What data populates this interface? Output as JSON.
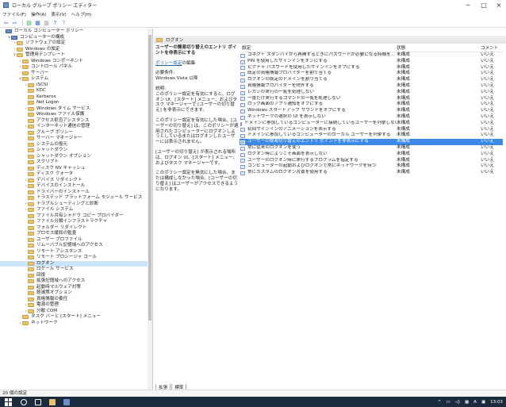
{
  "window": {
    "title": "ローカル グループ ポリシー エディター",
    "minimize": "─",
    "maximize": "□",
    "close": "×"
  },
  "menu": [
    "ファイル(F)",
    "操作(A)",
    "表示(V)",
    "ヘルプ(H)"
  ],
  "toolbar": {
    "back": "⇦",
    "forward": "⇨",
    "up": "▤",
    "view1": "▦",
    "help": "?",
    "view2": "▥",
    "filter": "⊤"
  },
  "tree": [
    {
      "indent": 0,
      "arrow": "",
      "type": "pc",
      "label": "ローカル コンピューター ポリシー"
    },
    {
      "indent": 1,
      "arrow": "∨",
      "type": "pc",
      "label": "コンピューターの構成"
    },
    {
      "indent": 2,
      "arrow": "›",
      "type": "folder",
      "label": "ソフトウェアの設定"
    },
    {
      "indent": 2,
      "arrow": "›",
      "type": "folder",
      "label": "Windows の設定"
    },
    {
      "indent": 2,
      "arrow": "∨",
      "type": "folder",
      "label": "管理用テンプレート"
    },
    {
      "indent": 3,
      "arrow": "›",
      "type": "folder",
      "label": "Windows コンポーネント"
    },
    {
      "indent": 3,
      "arrow": "›",
      "type": "folder",
      "label": "コントロール パネル"
    },
    {
      "indent": 3,
      "arrow": "",
      "type": "folder",
      "label": "サーバー"
    },
    {
      "indent": 3,
      "arrow": "∨",
      "type": "folder",
      "label": "システム"
    },
    {
      "indent": 4,
      "arrow": "›",
      "type": "folder",
      "label": "iSCSI"
    },
    {
      "indent": 4,
      "arrow": "",
      "type": "folder",
      "label": "KDC"
    },
    {
      "indent": 4,
      "arrow": "",
      "type": "folder",
      "label": "Kerberos"
    },
    {
      "indent": 4,
      "arrow": "",
      "type": "folder",
      "label": "Net Logon"
    },
    {
      "indent": 4,
      "arrow": "›",
      "type": "folder",
      "label": "Windows タイム サービス"
    },
    {
      "indent": 4,
      "arrow": "",
      "type": "folder",
      "label": "Windows ファイル保護"
    },
    {
      "indent": 4,
      "arrow": "",
      "type": "folder",
      "label": "アクセス拒否アシスタンス"
    },
    {
      "indent": 4,
      "arrow": "›",
      "type": "folder",
      "label": "インターネット通信の管理"
    },
    {
      "indent": 4,
      "arrow": "",
      "type": "folder",
      "label": "グループ ポリシー"
    },
    {
      "indent": 4,
      "arrow": "",
      "type": "folder",
      "label": "サーバー マネージャー"
    },
    {
      "indent": 4,
      "arrow": "",
      "type": "folder",
      "label": "システムの復元"
    },
    {
      "indent": 4,
      "arrow": "",
      "type": "folder",
      "label": "シャットダウン"
    },
    {
      "indent": 4,
      "arrow": "",
      "type": "folder",
      "label": "シャットダウン オプション"
    },
    {
      "indent": 4,
      "arrow": "",
      "type": "folder",
      "label": "スクリプト"
    },
    {
      "indent": 4,
      "arrow": "",
      "type": "folder",
      "label": "ディスク NV キャッシュ"
    },
    {
      "indent": 4,
      "arrow": "",
      "type": "folder",
      "label": "ディスク クォータ"
    },
    {
      "indent": 4,
      "arrow": "›",
      "type": "folder",
      "label": "デバイス リダイレクト"
    },
    {
      "indent": 4,
      "arrow": "›",
      "type": "folder",
      "label": "デバイスのインストール"
    },
    {
      "indent": 4,
      "arrow": "",
      "type": "folder",
      "label": "ドライバーのインストール"
    },
    {
      "indent": 4,
      "arrow": "",
      "type": "folder",
      "label": "トラステッド プラットフォーム モジュール サービス"
    },
    {
      "indent": 4,
      "arrow": "›",
      "type": "folder",
      "label": "トラブルシューティングと診断"
    },
    {
      "indent": 4,
      "arrow": "›",
      "type": "folder",
      "label": "ファイル システム"
    },
    {
      "indent": 4,
      "arrow": "",
      "type": "folder",
      "label": "ファイル共有シャドウ コピー プロバイダー"
    },
    {
      "indent": 4,
      "arrow": "",
      "type": "folder",
      "label": "ファイル分類インフラストラクチャ"
    },
    {
      "indent": 4,
      "arrow": "",
      "type": "folder",
      "label": "フォルダー リダイレクト"
    },
    {
      "indent": 4,
      "arrow": "",
      "type": "folder",
      "label": "プロセス緩和の監査"
    },
    {
      "indent": 4,
      "arrow": "",
      "type": "folder",
      "label": "ユーザー プロファイル"
    },
    {
      "indent": 4,
      "arrow": "",
      "type": "folder",
      "label": "リムーバブル記憶域へのアクセス"
    },
    {
      "indent": 4,
      "arrow": "",
      "type": "folder",
      "label": "リモート アシスタンス"
    },
    {
      "indent": 4,
      "arrow": "",
      "type": "folder",
      "label": "リモート プロシージャ コール"
    },
    {
      "indent": 4,
      "arrow": "",
      "type": "folder",
      "label": "ログオン",
      "selected": true
    },
    {
      "indent": 4,
      "arrow": "",
      "type": "folder",
      "label": "ロケール サービス"
    },
    {
      "indent": 4,
      "arrow": "",
      "type": "folder",
      "label": "回復"
    },
    {
      "indent": 4,
      "arrow": "",
      "type": "folder",
      "label": "拡張記憶域へのアクセス"
    },
    {
      "indent": 4,
      "arrow": "",
      "type": "folder",
      "label": "起動時マルウェア対策"
    },
    {
      "indent": 4,
      "arrow": "",
      "type": "folder",
      "label": "軽減策オプション"
    },
    {
      "indent": 4,
      "arrow": "",
      "type": "folder",
      "label": "資格情報の委任"
    },
    {
      "indent": 4,
      "arrow": "›",
      "type": "folder",
      "label": "電源の管理"
    },
    {
      "indent": 4,
      "arrow": "›",
      "type": "folder",
      "label": "分散 COM"
    },
    {
      "indent": 3,
      "arrow": "",
      "type": "folder",
      "label": "タスク バーと [スタート] メニュー"
    },
    {
      "indent": 3,
      "arrow": "›",
      "type": "folder",
      "label": "ネットワーク"
    }
  ],
  "header": {
    "title": "ログオン"
  },
  "description": {
    "heading": "ユーザーの簡易切り替えのエントリ ポイントを非表示にする",
    "edit_prefix": "",
    "edit_link": "ポリシー設定",
    "edit_suffix": "の編集",
    "requirements_label": "必要条件:",
    "requirements_value": "Windows Vista 以降",
    "desc_label": "説明:",
    "p1": "このポリシー設定を有効にすると、ログオン UI、[スタート] メニュー、およびタスク マネージャーで [ユーザーの切り替え] を非表示にできます。",
    "p2": "このポリシー設定を有効にした場合、[ユーザーの切り替え] は、このポリシーが適用されたコンピューターにログオンしようとしているまたはログオンしたユーザーには表示されません。",
    "p3": "[ユーザーの切り替え] が表示される場所は、ログオン UI、[スタート] メニュー、およびタスク マネージャーです。",
    "p4": "このポリシー設定を無効にした場合、または構成しなかった場合、[ユーザーの切り替え] はユーザーがアクセスできるようになります。"
  },
  "table": {
    "headers": {
      "setting": "設定",
      "state": "状態",
      "comment": "コメント"
    },
    "rows": [
      {
        "setting": "コネクト スタンバイから再開するときにパスワードが必要になる時間を...",
        "state": "未構成",
        "comment": "いいえ"
      },
      {
        "setting": "PIN を使用したサインインをオンにする",
        "state": "未構成",
        "comment": "いいえ"
      },
      {
        "setting": "ピクチャ パスワードを使用したサインインをオフにする",
        "state": "未構成",
        "comment": "いいえ"
      },
      {
        "setting": "既定の資格情報プロバイダーを割り当てる",
        "state": "未構成",
        "comment": "いいえ"
      },
      {
        "setting": "ログオンの既定のドメインを割り当てる",
        "state": "未構成",
        "comment": "いいえ"
      },
      {
        "setting": "資格情報プロバイダーを除外する",
        "state": "未構成",
        "comment": "いいえ"
      },
      {
        "setting": "レガシの実行の一覧を処理しない",
        "state": "未構成",
        "comment": "いいえ"
      },
      {
        "setting": "一度だけ実行するコマンドの一覧を処理しない",
        "state": "未構成",
        "comment": "いいえ"
      },
      {
        "setting": "ロック画面のアプリ通知をオフにする",
        "state": "未構成",
        "comment": "いいえ"
      },
      {
        "setting": "Windows スタートアップ サウンドをオフにする",
        "state": "未構成",
        "comment": "いいえ"
      },
      {
        "setting": "ネットワークの選択の UI を表示しない",
        "state": "未構成",
        "comment": "いいえ"
      },
      {
        "setting": "ドメインに参加しているコンピューターに接続しているユーザーを列挙しない",
        "state": "未構成",
        "comment": "いいえ"
      },
      {
        "setting": "初回サインインのアニメーションを表示する",
        "state": "未構成",
        "comment": "いいえ"
      },
      {
        "setting": "ドメインに参加しているコンピューターのローカル ユーザーを列挙する",
        "state": "未構成",
        "comment": "いいえ"
      },
      {
        "setting": "ユーザーの簡易切り替えのエントリ ポイントを非表示にする",
        "state": "未構成",
        "comment": "いいえ",
        "selected": true
      },
      {
        "setting": "常に従来のログオンを使う",
        "state": "未構成",
        "comment": "いいえ"
      },
      {
        "setting": "ログオン時にようこそ画面を表示しない",
        "state": "未構成",
        "comment": "いいえ"
      },
      {
        "setting": "ユーザーのログオン時に実行するプログラムを指定する",
        "state": "未構成",
        "comment": "いいえ"
      },
      {
        "setting": "コンピューターの起動およびログオンで常にネットワークを待つ",
        "state": "未構成",
        "comment": "いいえ"
      },
      {
        "setting": "常にカスタムのログオン背景を使用する",
        "state": "未構成",
        "comment": "いいえ"
      }
    ]
  },
  "tabs": [
    "拡張",
    "標準"
  ],
  "status": "20 個の設定",
  "tray": {
    "time": "13:03",
    "lang": "A"
  },
  "colors": {
    "selection": "#3b8ae8",
    "tree_selection": "#cce4f7",
    "taskbar": "#1b2a3c"
  }
}
